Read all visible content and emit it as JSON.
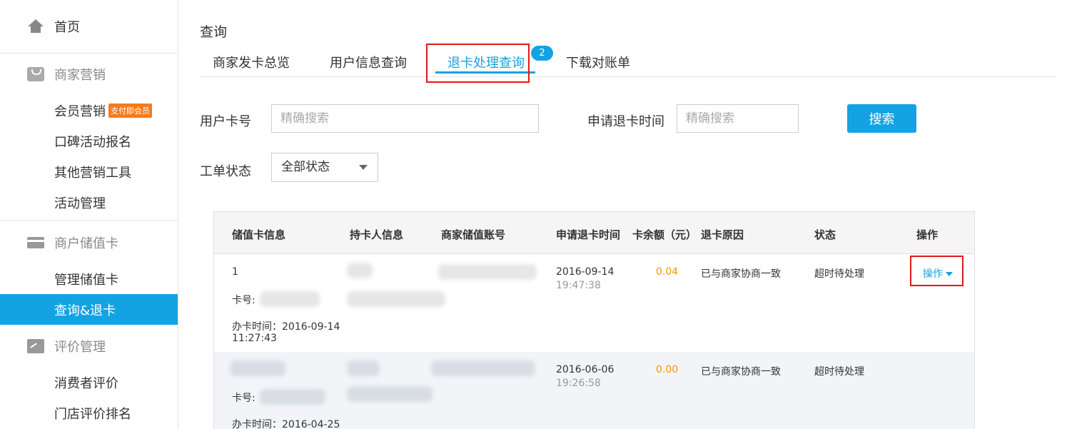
{
  "sidebar": {
    "home": "首页",
    "marketing": {
      "title": "商家营销",
      "items": [
        {
          "label": "会员营销",
          "badge": "支付即会员"
        },
        {
          "label": "口碑活动报名"
        },
        {
          "label": "其他营销工具"
        },
        {
          "label": "活动管理"
        }
      ]
    },
    "stored_card": {
      "title": "商户储值卡",
      "items": [
        {
          "label": "管理储值卡"
        },
        {
          "label": "查询&退卡",
          "active": true
        }
      ]
    },
    "reviews": {
      "title": "评价管理",
      "items": [
        {
          "label": "消费者评价"
        },
        {
          "label": "门店评价排名"
        }
      ]
    }
  },
  "page": {
    "title": "查询",
    "tabs": [
      {
        "label": "商家发卡总览"
      },
      {
        "label": "用户信息查询"
      },
      {
        "label": "退卡处理查询",
        "active": true,
        "badge": "2"
      },
      {
        "label": "下载对账单"
      }
    ]
  },
  "filters": {
    "card_no_label": "用户卡号",
    "card_no_placeholder": "精确搜索",
    "refund_time_label": "申请退卡时间",
    "refund_time_placeholder": "精确搜索",
    "search_button": "搜索",
    "status_label": "工单状态",
    "status_value": "全部状态"
  },
  "table": {
    "headers": [
      "储值卡信息",
      "持卡人信息",
      "商家储值账号",
      "申请退卡时间",
      "卡余额（元）",
      "退卡原因",
      "状态",
      "操作"
    ],
    "rows": [
      {
        "card_id": "1",
        "card_no_label": "卡号:",
        "issue_label": "办卡时间：2016-09-14",
        "issue_time": "11:27:43",
        "apply_date": "2016-09-14",
        "apply_time": "19:47:38",
        "balance": "0.04",
        "reason": "已与商家协商一致",
        "status": "超时待处理",
        "action": "操作"
      },
      {
        "card_id": "",
        "card_no_label": "卡号:",
        "issue_label": "办卡时间：2016-04-25",
        "issue_time": "",
        "apply_date": "2016-06-06",
        "apply_time": "19:26:58",
        "balance": "0.00",
        "reason": "已与商家协商一致",
        "status": "超时待处理",
        "action": ""
      }
    ]
  },
  "colors": {
    "accent": "#13a3e3",
    "highlight_box": "#e01818",
    "amount": "#f39800",
    "badge": "#f47b1e"
  }
}
